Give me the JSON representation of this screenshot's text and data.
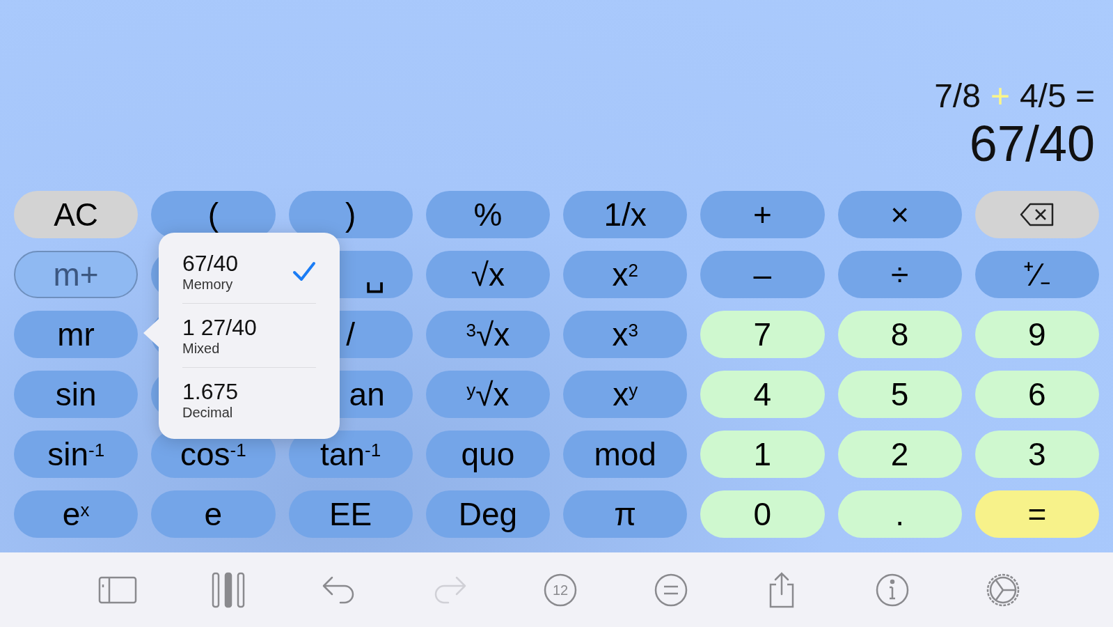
{
  "display": {
    "expression": {
      "left": "7/8",
      "operator": "+",
      "right": "4/5 ="
    },
    "result": "67/40"
  },
  "keys": [
    [
      {
        "label": "AC",
        "kind": "gray"
      },
      {
        "label": "(",
        "kind": "fn"
      },
      {
        "label": ")",
        "kind": "fn"
      },
      {
        "label": "%",
        "kind": "fn"
      },
      {
        "label": "1/x",
        "kind": "fn"
      },
      {
        "label": "+",
        "kind": "fn"
      },
      {
        "label": "×",
        "kind": "fn"
      },
      {
        "kind": "backspace"
      }
    ],
    [
      {
        "label": "m+",
        "kind": "outline"
      },
      {
        "kind": "fn"
      },
      {
        "label": "␣",
        "kind": "fn",
        "partial": true
      },
      {
        "label": "√x",
        "kind": "fn"
      },
      {
        "label": "x$^{2}$",
        "kind": "fn"
      },
      {
        "label": "–",
        "kind": "fn"
      },
      {
        "label": "÷",
        "kind": "fn"
      },
      {
        "label": "⁺∕₋",
        "kind": "fn"
      }
    ],
    [
      {
        "label": "mr",
        "kind": "fn"
      },
      {
        "kind": "fn"
      },
      {
        "label": "/",
        "kind": "fn"
      },
      {
        "label": "$^{3}$√x",
        "kind": "fn"
      },
      {
        "label": "x$^{3}$",
        "kind": "fn"
      },
      {
        "label": "7",
        "kind": "digit"
      },
      {
        "label": "8",
        "kind": "digit"
      },
      {
        "label": "9",
        "kind": "digit"
      }
    ],
    [
      {
        "label": "sin",
        "kind": "fn"
      },
      {
        "kind": "fn"
      },
      {
        "label": "an",
        "kind": "fn",
        "partial": true
      },
      {
        "label": "$^{y}$√x",
        "kind": "fn"
      },
      {
        "label": "x$^{y}$",
        "kind": "fn"
      },
      {
        "label": "4",
        "kind": "digit"
      },
      {
        "label": "5",
        "kind": "digit"
      },
      {
        "label": "6",
        "kind": "digit"
      }
    ],
    [
      {
        "label": "sin$^{-1}$",
        "kind": "fn"
      },
      {
        "label": "cos$^{-1}$",
        "kind": "fn"
      },
      {
        "label": "tan$^{-1}$",
        "kind": "fn"
      },
      {
        "label": "quo",
        "kind": "fn"
      },
      {
        "label": "mod",
        "kind": "fn"
      },
      {
        "label": "1",
        "kind": "digit"
      },
      {
        "label": "2",
        "kind": "digit"
      },
      {
        "label": "3",
        "kind": "digit"
      }
    ],
    [
      {
        "label": "e$^{x}$",
        "kind": "fn"
      },
      {
        "label": "e",
        "kind": "fn"
      },
      {
        "label": "EE",
        "kind": "fn"
      },
      {
        "label": "Deg",
        "kind": "fn"
      },
      {
        "label": "π",
        "kind": "fn"
      },
      {
        "label": "0",
        "kind": "digit"
      },
      {
        "label": ".",
        "kind": "digit"
      },
      {
        "label": "=",
        "kind": "equals"
      }
    ]
  ],
  "popup": {
    "items": [
      {
        "value": "67/40",
        "caption": "Memory",
        "selected": true
      },
      {
        "value": "1 27/40",
        "caption": "Mixed",
        "selected": false
      },
      {
        "value": "1.675",
        "caption": "Decimal",
        "selected": false
      }
    ]
  },
  "toolbar": [
    {
      "kind": "sidebar",
      "disabled": false
    },
    {
      "kind": "columns",
      "disabled": false
    },
    {
      "kind": "undo",
      "disabled": false
    },
    {
      "kind": "redo",
      "disabled": true
    },
    {
      "kind": "fraction",
      "label": "12",
      "disabled": false
    },
    {
      "kind": "equals",
      "disabled": false
    },
    {
      "kind": "share",
      "disabled": false
    },
    {
      "kind": "info",
      "disabled": false
    },
    {
      "kind": "settings",
      "disabled": false
    }
  ]
}
